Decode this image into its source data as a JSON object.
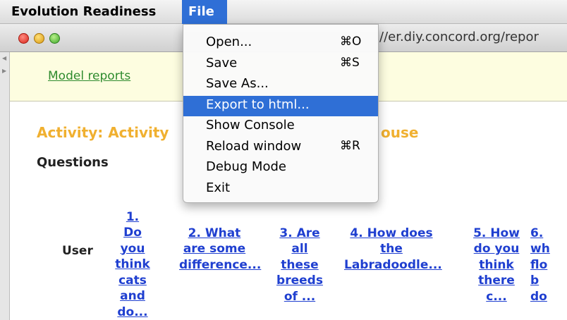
{
  "menubar": {
    "app_name": "Evolution Readiness",
    "file_menu": "File"
  },
  "window": {
    "url": "//er.diy.concord.org/repor"
  },
  "page": {
    "model_reports_link": "Model reports",
    "activity_title": "Activity: Activity",
    "activity_title_tail": "ouse",
    "questions_heading": "Questions",
    "user_column": "User",
    "questions": [
      {
        "lines": [
          "1.",
          "Do",
          "you",
          "think",
          "cats",
          "and",
          "do..."
        ]
      },
      {
        "lines": [
          "2. What",
          "are some",
          "difference..."
        ]
      },
      {
        "lines": [
          "3. Are",
          "all",
          "these",
          "breeds",
          "of ..."
        ]
      },
      {
        "lines": [
          "4. How does",
          "the",
          "Labradoodle..."
        ]
      },
      {
        "lines": [
          "5. How",
          "do you",
          "think",
          "there",
          "c..."
        ]
      },
      {
        "lines": [
          "6.",
          "wh",
          "flo",
          "b",
          "do"
        ]
      }
    ]
  },
  "file_menu_items": [
    {
      "label": "Open...",
      "shortcut": "⌘O",
      "highlighted": false
    },
    {
      "label": "Save",
      "shortcut": "⌘S",
      "highlighted": false
    },
    {
      "label": "Save As...",
      "shortcut": "",
      "highlighted": false
    },
    {
      "label": "Export to html...",
      "shortcut": "",
      "highlighted": true
    },
    {
      "label": "Show Console",
      "shortcut": "",
      "highlighted": false
    },
    {
      "label": "Reload window",
      "shortcut": "⌘R",
      "highlighted": false
    },
    {
      "label": "Debug Mode",
      "shortcut": "",
      "highlighted": false
    },
    {
      "label": "Exit",
      "shortcut": "",
      "highlighted": false
    }
  ]
}
